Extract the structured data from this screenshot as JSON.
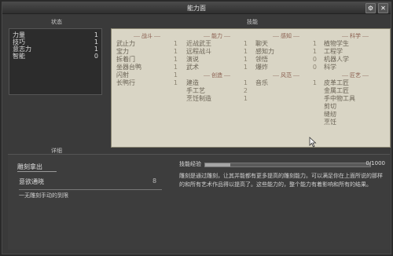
{
  "window": {
    "title": "能力面"
  },
  "icons": [
    "gear-icon",
    "close-icon"
  ],
  "left_panel": {
    "tab_label": "状态",
    "rows": [
      {
        "label": "力量",
        "value": "1"
      },
      {
        "label": "技巧",
        "value": "1"
      },
      {
        "label": "意志力",
        "value": "1"
      },
      {
        "label": "智能",
        "value": "0"
      }
    ]
  },
  "skills": {
    "tab_label": "技能",
    "columns": [
      {
        "groups": [
          {
            "category": "战斗",
            "items": [
              {
                "label": "武止力",
                "value": "1"
              },
              {
                "label": "宝力",
                "value": "1"
              },
              {
                "label": "拆着门",
                "value": "1"
              },
              {
                "label": "坐器台鸭",
                "value": "1"
              },
              {
                "label": "闪射",
                "value": "1"
              },
              {
                "label": "长鸭行",
                "value": "1"
              }
            ]
          }
        ]
      },
      {
        "groups": [
          {
            "category": "能力",
            "items": [
              {
                "label": "近战武王",
                "value": "1"
              },
              {
                "label": "远程战斗",
                "value": "1"
              },
              {
                "label": "演说",
                "value": "1"
              },
              {
                "label": "武术",
                "value": "1"
              }
            ]
          },
          {
            "category": "创造",
            "items": [
              {
                "label": "建造",
                "value": "1"
              },
              {
                "label": "手工艺",
                "value": "2"
              },
              {
                "label": "烹饪制造",
                "value": "1"
              }
            ]
          }
        ]
      },
      {
        "groups": [
          {
            "category": "感知",
            "items": [
              {
                "label": "聊天",
                "value": "1"
              },
              {
                "label": "感知力",
                "value": "1"
              },
              {
                "label": "领悟",
                "value": "0"
              },
              {
                "label": "爆炸",
                "value": "0"
              }
            ]
          },
          {
            "category": "风范",
            "items": [
              {
                "label": "音乐",
                "value": "1"
              }
            ]
          }
        ]
      },
      {
        "groups": [
          {
            "category": "科学",
            "items": [
              {
                "label": "植物学生",
                "value": ""
              },
              {
                "label": "工程学",
                "value": ""
              },
              {
                "label": "机器人学",
                "value": ""
              },
              {
                "label": "科学",
                "value": ""
              }
            ]
          },
          {
            "category": "匠艺",
            "items": [
              {
                "label": "皮革工匠",
                "value": ""
              },
              {
                "label": "金属工匠",
                "value": ""
              },
              {
                "label": "手中物工具",
                "value": ""
              },
              {
                "label": "剪切",
                "value": ""
              },
              {
                "label": "缝纫",
                "value": ""
              },
              {
                "label": "烹饪",
                "value": ""
              }
            ]
          }
        ]
      }
    ]
  },
  "bottom_tab_label": "详细",
  "detail": {
    "title": "雕刻拿出",
    "row_label": "意欲通晓",
    "row_value": "8",
    "row2_label": "一无雕刻手动的到限",
    "progress_label": "技能经验",
    "progress_value": "0/1000",
    "progress_fraction": 0.15,
    "description": "雕刻是通过雕刻，让其并能都有更多提高的雕刻能力。可以满足你在上面所说的那样的和所有艺术作品得以提高了。这些能力的，整个能力有着影响和所有的结果。"
  }
}
